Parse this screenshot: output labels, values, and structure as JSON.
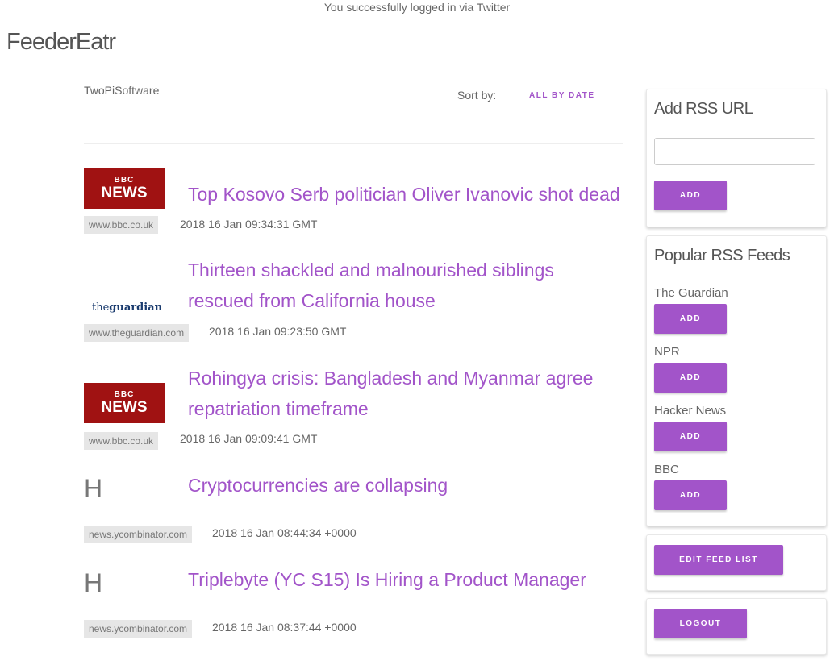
{
  "flash_message": "You successfully logged in via Twitter",
  "app_title": "FeederEatr",
  "username": "TwoPiSoftware",
  "sort": {
    "label": "Sort by:",
    "option": "ALL BY DATE"
  },
  "colors": {
    "accent": "#a254c9",
    "bbc_red": "#a01212",
    "source_bg": "#e6e6e6"
  },
  "feed_items": [
    {
      "thumb_type": "bbc",
      "thumb_top": "BBC",
      "thumb_bottom": "NEWS",
      "title": "Top Kosovo Serb politician Oliver Ivanovic shot dead",
      "source": "www.bbc.co.uk",
      "date": "2018 16 Jan 09:34:31 GMT"
    },
    {
      "thumb_type": "guardian",
      "thumb_the": "the",
      "thumb_name": "guardian",
      "title": "Thirteen shackled and malnourished siblings rescued from California house",
      "source": "www.theguardian.com",
      "date": "2018 16 Jan 09:23:50 GMT"
    },
    {
      "thumb_type": "bbc",
      "thumb_top": "BBC",
      "thumb_bottom": "NEWS",
      "title": "Rohingya crisis: Bangladesh and Myanmar agree repatriation timeframe",
      "source": "www.bbc.co.uk",
      "date": "2018 16 Jan 09:09:41 GMT"
    },
    {
      "thumb_type": "letter",
      "thumb_letter": "H",
      "title": "Cryptocurrencies are collapsing",
      "source": "news.ycombinator.com",
      "date": "2018 16 Jan 08:44:34 +0000"
    },
    {
      "thumb_type": "letter",
      "thumb_letter": "H",
      "title": "Triplebyte (YC S15) Is Hiring a Product Manager",
      "source": "news.ycombinator.com",
      "date": "2018 16 Jan 08:37:44 +0000"
    }
  ],
  "sidebar": {
    "add_rss": {
      "title": "Add RSS URL",
      "input_value": "",
      "button": "ADD"
    },
    "popular": {
      "title": "Popular RSS Feeds",
      "feeds": [
        {
          "name": "The Guardian",
          "button": "ADD"
        },
        {
          "name": "NPR",
          "button": "ADD"
        },
        {
          "name": "Hacker News",
          "button": "ADD"
        },
        {
          "name": "BBC",
          "button": "ADD"
        }
      ]
    },
    "edit_button": "EDIT FEED LIST",
    "logout_button": "LOGOUT"
  }
}
